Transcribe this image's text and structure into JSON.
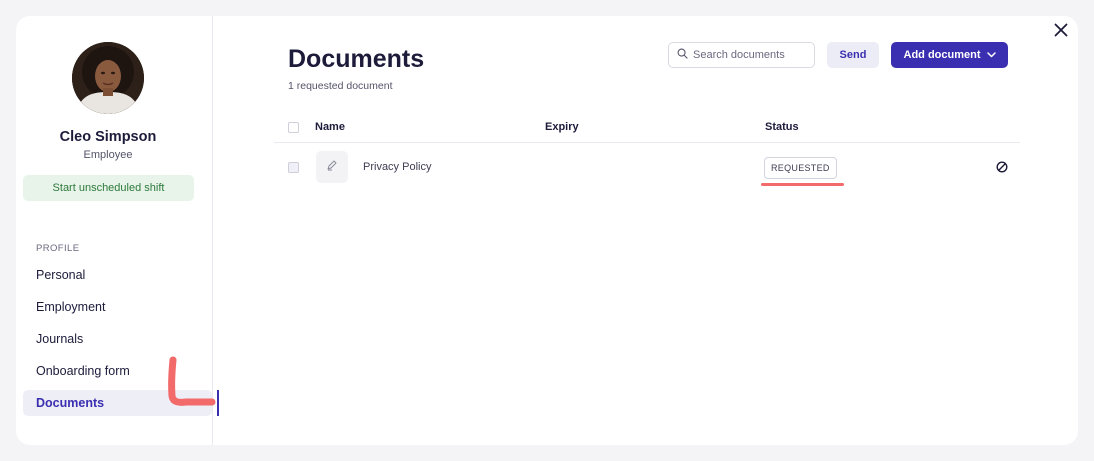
{
  "profile": {
    "name": "Cleo Simpson",
    "role": "Employee",
    "shift_button": "Start unscheduled shift"
  },
  "nav": {
    "section_label": "PROFILE",
    "items": [
      {
        "label": "Personal",
        "active": false
      },
      {
        "label": "Employment",
        "active": false
      },
      {
        "label": "Journals",
        "active": false
      },
      {
        "label": "Onboarding form",
        "active": false
      },
      {
        "label": "Documents",
        "active": true
      }
    ]
  },
  "main": {
    "title": "Documents",
    "subtitle": "1 requested document",
    "search": {
      "placeholder": "Search documents",
      "value": ""
    },
    "send_label": "Send",
    "add_label": "Add document",
    "table": {
      "columns": [
        "Name",
        "Expiry",
        "Status"
      ],
      "rows": [
        {
          "name": "Privacy Policy",
          "expiry": "",
          "status": "REQUESTED"
        }
      ]
    }
  },
  "colors": {
    "accent": "#3a2fb0",
    "shift_bg": "#e8f4ea",
    "shift_text": "#2c7a3b",
    "annotation": "#f26a6a"
  },
  "icons": {
    "close": "close-icon",
    "search": "search-icon",
    "add_dropdown": "chevron-down-icon",
    "document": "signature-icon",
    "row_action": "block-icon"
  }
}
